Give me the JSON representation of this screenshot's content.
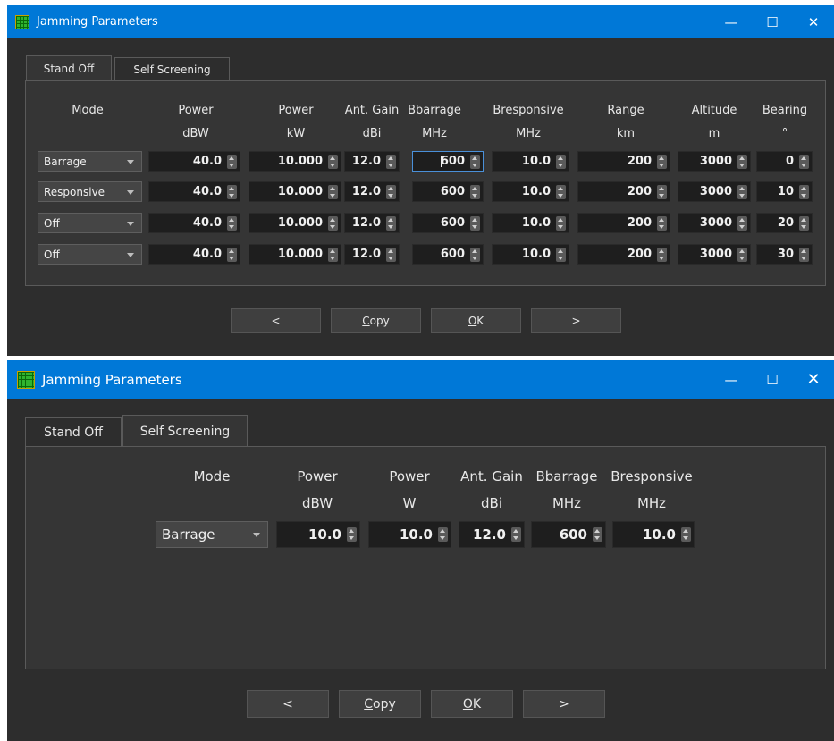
{
  "win1": {
    "title": "Jamming Parameters",
    "controls": {
      "minimize": "—",
      "maximize": "☐",
      "close": "✕"
    },
    "tabs": [
      "Stand Off",
      "Self Screening"
    ],
    "headers": [
      {
        "l1": "Mode",
        "l2": ""
      },
      {
        "l1": "Power",
        "l2": "dBW"
      },
      {
        "l1": "Power",
        "l2": "kW"
      },
      {
        "l1": "Ant. Gain",
        "l2": "dBi"
      },
      {
        "l1": "Bbarrage",
        "l2": "MHz"
      },
      {
        "l1": "Bresponsive",
        "l2": "MHz"
      },
      {
        "l1": "Range",
        "l2": "km"
      },
      {
        "l1": "Altitude",
        "l2": "m"
      },
      {
        "l1": "Bearing",
        "l2": "°"
      }
    ],
    "rows": [
      {
        "mode": "Barrage",
        "power_dbw": "40.0",
        "power_kw": "10.000",
        "gain": "12.0",
        "bbarrage": "600",
        "bresp": "10.0",
        "range": "200",
        "alt": "3000",
        "bearing": "0"
      },
      {
        "mode": "Responsive",
        "power_dbw": "40.0",
        "power_kw": "10.000",
        "gain": "12.0",
        "bbarrage": "600",
        "bresp": "10.0",
        "range": "200",
        "alt": "3000",
        "bearing": "10"
      },
      {
        "mode": "Off",
        "power_dbw": "40.0",
        "power_kw": "10.000",
        "gain": "12.0",
        "bbarrage": "600",
        "bresp": "10.0",
        "range": "200",
        "alt": "3000",
        "bearing": "20"
      },
      {
        "mode": "Off",
        "power_dbw": "40.0",
        "power_kw": "10.000",
        "gain": "12.0",
        "bbarrage": "600",
        "bresp": "10.0",
        "range": "200",
        "alt": "3000",
        "bearing": "30"
      }
    ],
    "buttons": {
      "prev": "<",
      "copy_u": "C",
      "copy_rest": "opy",
      "ok_u": "O",
      "ok_rest": "K",
      "next": ">"
    }
  },
  "win2": {
    "title": "Jamming Parameters",
    "controls": {
      "minimize": "—",
      "maximize": "☐",
      "close": "✕"
    },
    "tabs": [
      "Stand Off",
      "Self Screening"
    ],
    "headers": [
      {
        "l1": "Mode",
        "l2": ""
      },
      {
        "l1": "Power",
        "l2": "dBW"
      },
      {
        "l1": "Power",
        "l2": "W"
      },
      {
        "l1": "Ant. Gain",
        "l2": "dBi"
      },
      {
        "l1": "Bbarrage",
        "l2": "MHz"
      },
      {
        "l1": "Bresponsive",
        "l2": "MHz"
      }
    ],
    "row": {
      "mode": "Barrage",
      "power_dbw": "10.0",
      "power_w": "10.0",
      "gain": "12.0",
      "bbarrage": "600",
      "bresp": "10.0"
    },
    "buttons": {
      "prev": "<",
      "copy_u": "C",
      "copy_rest": "opy",
      "ok_u": "O",
      "ok_rest": "K",
      "next": ">"
    }
  },
  "colors": {
    "titlebar": "#0078d7",
    "background": "#2d2d2d",
    "panel": "#353535",
    "field": "#1e1e1e",
    "focus": "#4a90d9"
  }
}
